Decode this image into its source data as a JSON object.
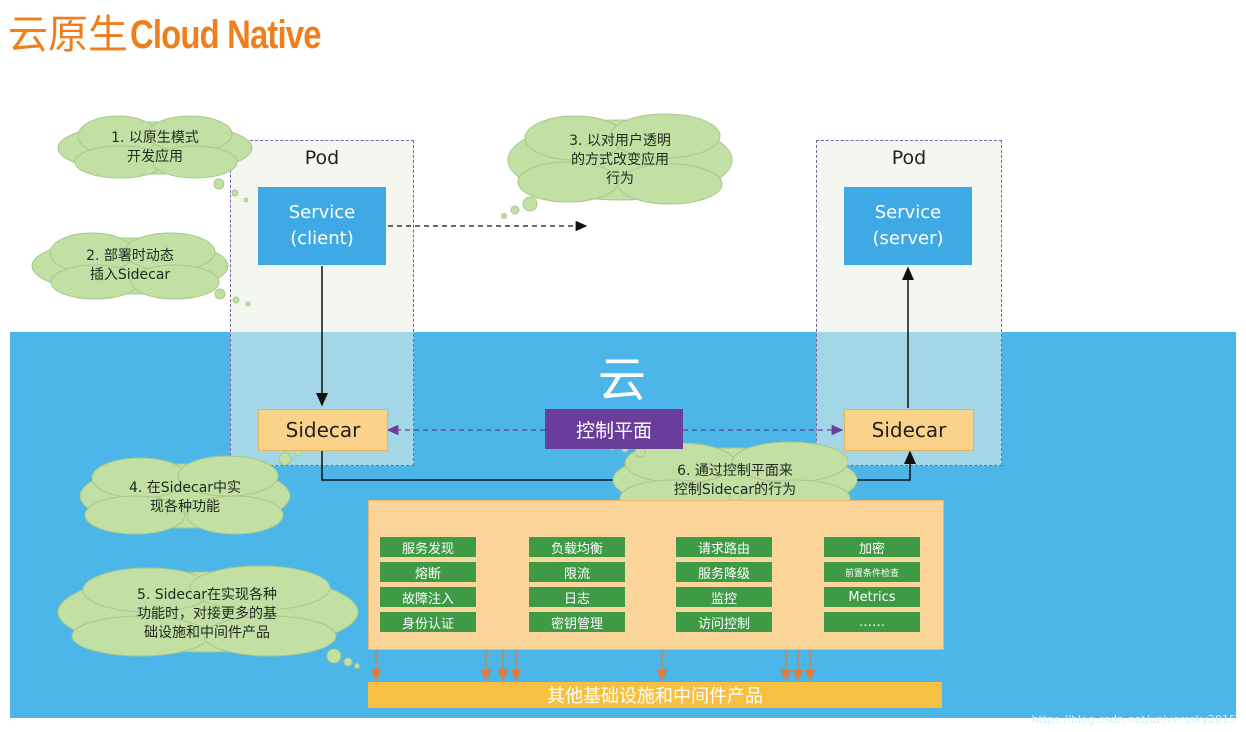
{
  "title": {
    "cn": "云原生",
    "en": "Cloud Native"
  },
  "pods": {
    "left": {
      "label": "Pod",
      "service": "Service\n(client)",
      "sidecar": "Sidecar"
    },
    "right": {
      "label": "Pod",
      "service": "Service\n(server)",
      "sidecar": "Sidecar"
    }
  },
  "cloud_label": "云",
  "control_plane": "控制平面",
  "callouts": {
    "c1": "1. 以原生模式\n开发应用",
    "c2": "2. 部署时动态\n插入Sidecar",
    "c3": "3. 以对用户透明\n的方式改变应用\n行为",
    "c4": "4. 在Sidecar中实\n现各种功能",
    "c5": "5. Sidecar在实现各种\n功能时，对接更多的基\n础设施和中间件产品",
    "c6": "6. 通过控制平面来\n控制Sidecar的行为"
  },
  "features": {
    "col1": [
      "服务发现",
      "熔断",
      "故障注入",
      "身份认证"
    ],
    "col2": [
      "负载均衡",
      "限流",
      "日志",
      "密钥管理"
    ],
    "col3": [
      "请求路由",
      "服务降级",
      "监控",
      "访问控制"
    ],
    "col4": [
      "加密",
      "前置条件检查",
      "Metrics",
      "……"
    ]
  },
  "infra_bar": "其他基础设施和中间件产品",
  "watermark": "https://blog.csdn.net/universsky2015",
  "colors": {
    "title_orange": "#f07e1c",
    "cloud_blue": "#4db6e8",
    "service_blue": "#3fa9e5",
    "sidecar_peach": "#fbd289",
    "control_purple": "#6a3d9a",
    "chip_green": "#3f9a45",
    "panel_peach": "#fcd59a",
    "bar_yellow": "#f7c040",
    "callout_green": "#c2dfa4"
  }
}
